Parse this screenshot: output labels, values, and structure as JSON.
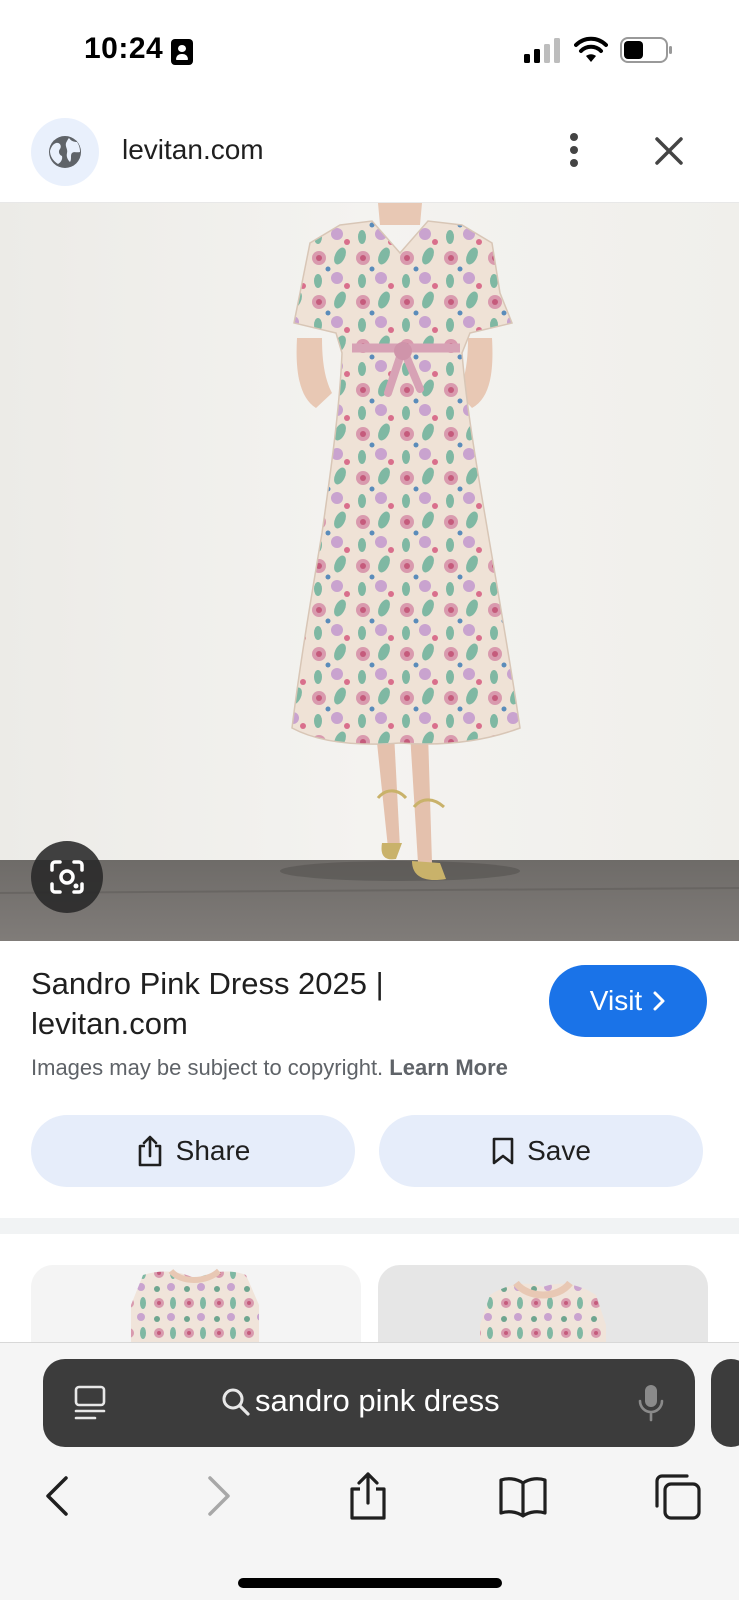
{
  "status_bar": {
    "time": "10:24",
    "icons": [
      "contact-badge-icon",
      "signal-icon",
      "wifi-icon",
      "battery-icon"
    ]
  },
  "header": {
    "domain": "levitan.com",
    "icons": [
      "globe-icon",
      "more-vert-icon",
      "close-icon"
    ]
  },
  "result": {
    "title": "Sandro Pink Dress 2025 | levitan.com",
    "visit_label": "Visit",
    "copyright_text": "Images may be subject to copyright.",
    "learn_more_label": "Learn More",
    "share_label": "Share",
    "save_label": "Save"
  },
  "search_bar": {
    "query": "sandro pink dress"
  },
  "toolbar": {
    "icons": [
      "back-icon",
      "forward-icon",
      "share-icon",
      "bookmarks-icon",
      "tabs-icon"
    ]
  },
  "colors": {
    "accent": "#1a73e8",
    "pill_bg": "#e6edfa",
    "globe_bg": "#e9f0fc",
    "search_field_bg": "#3c3c3c"
  }
}
